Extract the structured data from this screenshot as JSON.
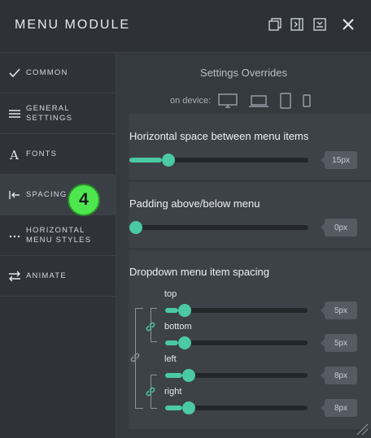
{
  "header": {
    "title": "MENU MODULE"
  },
  "sidebar": {
    "items": [
      {
        "label": "COMMON",
        "icon": "checkmark-icon"
      },
      {
        "label": "GENERAL\nSETTINGS",
        "icon": "hamburger-icon"
      },
      {
        "label": "FONTS",
        "icon": "font-a-icon"
      },
      {
        "label": "SPACING",
        "icon": "arrow-left-bar-icon"
      },
      {
        "label": "HORIZONTAL\nMENU STYLES",
        "icon": "ellipsis-icon"
      },
      {
        "label": "ANIMATE",
        "icon": "swap-arrows-icon"
      }
    ],
    "active_index": 3,
    "badge": "4"
  },
  "main": {
    "overrides_title": "Settings Overrides",
    "device_label": "on device:",
    "devices": [
      "desktop-icon",
      "laptop-icon",
      "tablet-icon",
      "phone-icon"
    ],
    "sections": {
      "horizontal": {
        "title": "Horizontal space between menu items",
        "value": "15px",
        "level": 0.18
      },
      "padding": {
        "title": "Padding above/below menu",
        "value": "0px",
        "level": 0.0
      },
      "dropdown": {
        "title": "Dropdown menu item spacing",
        "rows": [
          {
            "label": "top",
            "value": "5px",
            "level": 0.09
          },
          {
            "label": "bottom",
            "value": "5px",
            "level": 0.09
          },
          {
            "label": "left",
            "value": "8px",
            "level": 0.12
          },
          {
            "label": "right",
            "value": "8px",
            "level": 0.12
          }
        ]
      }
    }
  },
  "colors": {
    "accent": "#4bc9a4",
    "badge": "#4ee64f"
  }
}
